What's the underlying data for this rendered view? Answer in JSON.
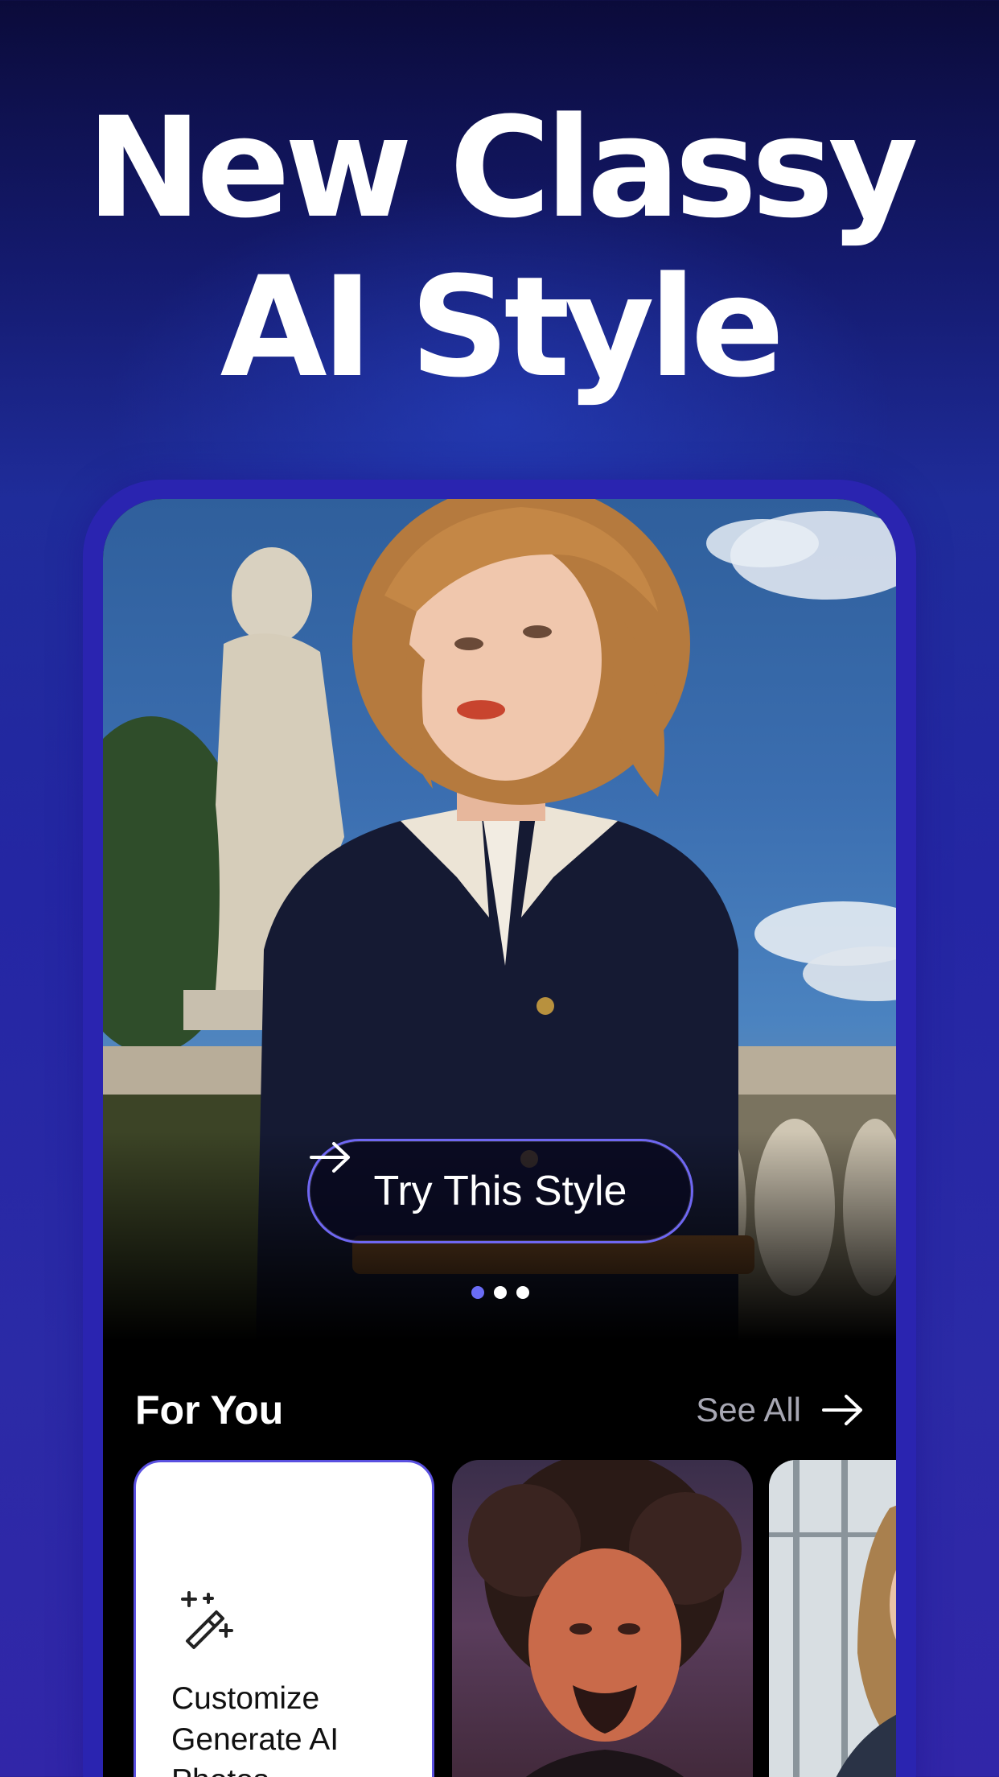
{
  "headline": {
    "line1": "New Classy",
    "line2": "AI Style"
  },
  "hero": {
    "cta_label": "Try This Style",
    "carousel": {
      "total": 3,
      "active": 1
    }
  },
  "for_you": {
    "title": "For You",
    "see_all_label": "See All",
    "cards": [
      {
        "kind": "customize",
        "label": "Customize Generate AI Photos",
        "icon": "magic-wand-icon"
      },
      {
        "kind": "style-preview",
        "label": ""
      },
      {
        "kind": "style-preview",
        "label": ""
      }
    ]
  },
  "colors": {
    "accent": "#6a6cf5",
    "background_top": "#0b0b3a",
    "background_bottom": "#3126a8",
    "frame": "#2a24b0"
  }
}
